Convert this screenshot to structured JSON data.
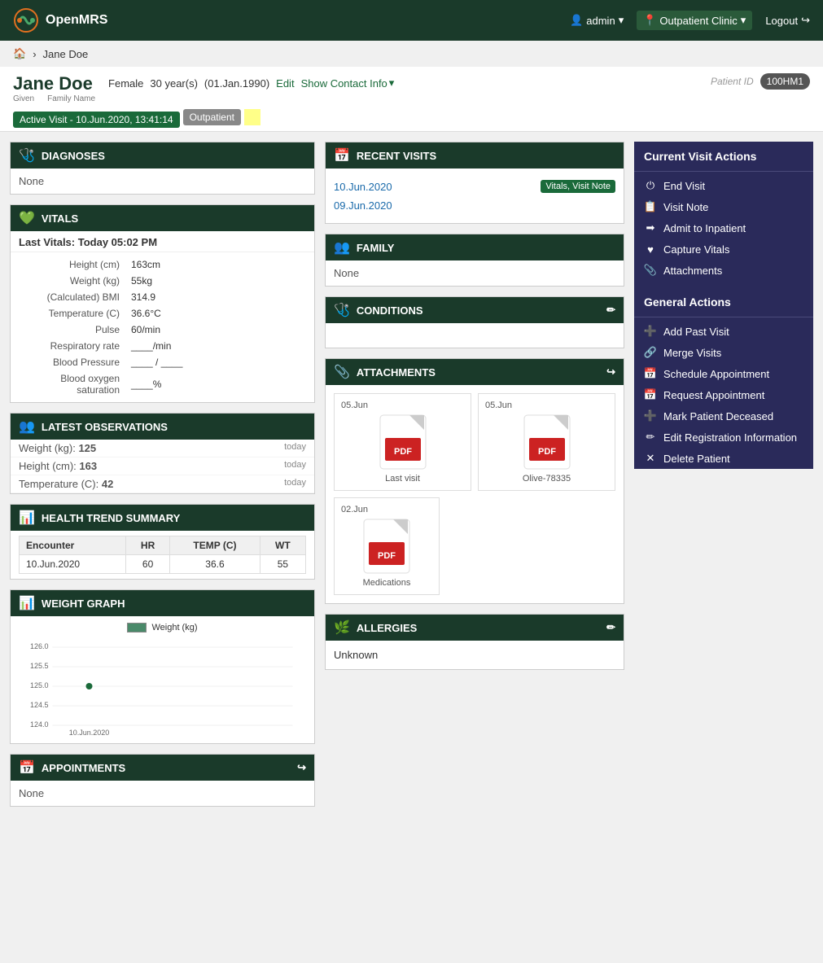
{
  "app": {
    "name": "OpenMRS",
    "logo_text": "OpenMRS"
  },
  "nav": {
    "user": "admin",
    "location": "Outpatient Clinic",
    "logout": "Logout"
  },
  "breadcrumb": {
    "home": "🏠",
    "patient": "Jane Doe"
  },
  "patient": {
    "given": "Jane Doe",
    "given_label": "Given",
    "family_name": "",
    "family_label": "Family Name",
    "gender": "Female",
    "age": "30 year(s)",
    "dob": "(01.Jan.1990)",
    "edit": "Edit",
    "show_contact": "Show Contact Info",
    "patient_id_label": "Patient ID",
    "patient_id": "100HM1",
    "visit_badge": "Active Visit - 10.Jun.2020, 13:41:14",
    "visit_type": "Outpatient"
  },
  "diagnoses": {
    "title": "DIAGNOSES",
    "value": "None"
  },
  "vitals": {
    "title": "VITALS",
    "last": "Last Vitals: Today 05:02 PM",
    "rows": [
      {
        "label": "Height (cm)",
        "value": "163cm"
      },
      {
        "label": "Weight (kg)",
        "value": "55kg"
      },
      {
        "label": "(Calculated) BMI",
        "value": "314.9"
      },
      {
        "label": "Temperature (C)",
        "value": "36.6°C"
      },
      {
        "label": "Pulse",
        "value": "60/min"
      },
      {
        "label": "Respiratory rate",
        "value": "____/min"
      },
      {
        "label": "Blood Pressure",
        "value": "____ / ____"
      },
      {
        "label": "Blood oxygen saturation",
        "value": "____%"
      }
    ]
  },
  "observations": {
    "title": "LATEST OBSERVATIONS",
    "rows": [
      {
        "label": "Weight (kg):",
        "value": "125",
        "time": "today"
      },
      {
        "label": "Height (cm):",
        "value": "163",
        "time": "today"
      },
      {
        "label": "Temperature (C):",
        "value": "42",
        "time": "today"
      }
    ]
  },
  "health_trend": {
    "title": "HEALTH TREND SUMMARY",
    "headers": [
      "Encounter",
      "HR",
      "TEMP (C)",
      "WT"
    ],
    "rows": [
      {
        "encounter": "10.Jun.2020",
        "hr": "60",
        "temp": "36.6",
        "wt": "55"
      }
    ]
  },
  "weight_graph": {
    "title": "WEIGHT GRAPH",
    "legend": "Weight (kg)",
    "y_labels": [
      "126.0",
      "125.5",
      "125.0",
      "124.5",
      "124.0"
    ],
    "x_label": "10.Jun.2020",
    "data_point": 125
  },
  "appointments": {
    "title": "APPOINTMENTS",
    "value": "None"
  },
  "recent_visits": {
    "title": "RECENT VISITS",
    "visits": [
      {
        "date": "10.Jun.2020",
        "tags": [
          "Vitals, Visit Note"
        ]
      },
      {
        "date": "09.Jun.2020",
        "tags": []
      }
    ]
  },
  "family": {
    "title": "FAMILY",
    "value": "None"
  },
  "conditions": {
    "title": "CONDITIONS"
  },
  "attachments": {
    "title": "ATTACHMENTS",
    "items": [
      {
        "date": "05.Jun",
        "label": "Last visit"
      },
      {
        "date": "05.Jun",
        "label": "Olive-78335"
      }
    ],
    "single": {
      "date": "02.Jun",
      "label": "Medications"
    }
  },
  "allergies": {
    "title": "ALLERGIES",
    "value": "Unknown"
  },
  "current_visit_actions": {
    "title": "Current Visit Actions",
    "items": [
      {
        "icon": "⏻",
        "label": "End Visit"
      },
      {
        "icon": "📋",
        "label": "Visit Note"
      },
      {
        "icon": "➡",
        "label": "Admit to Inpatient"
      },
      {
        "icon": "♥",
        "label": "Capture Vitals"
      },
      {
        "icon": "📎",
        "label": "Attachments"
      }
    ]
  },
  "general_actions": {
    "title": "General Actions",
    "items": [
      {
        "icon": "+",
        "label": "Add Past Visit"
      },
      {
        "icon": "🔗",
        "label": "Merge Visits"
      },
      {
        "icon": "📅",
        "label": "Schedule Appointment"
      },
      {
        "icon": "📅",
        "label": "Request Appointment"
      },
      {
        "icon": "+",
        "label": "Mark Patient Deceased"
      },
      {
        "icon": "✏",
        "label": "Edit Registration Information"
      },
      {
        "icon": "✕",
        "label": "Delete Patient"
      }
    ]
  }
}
